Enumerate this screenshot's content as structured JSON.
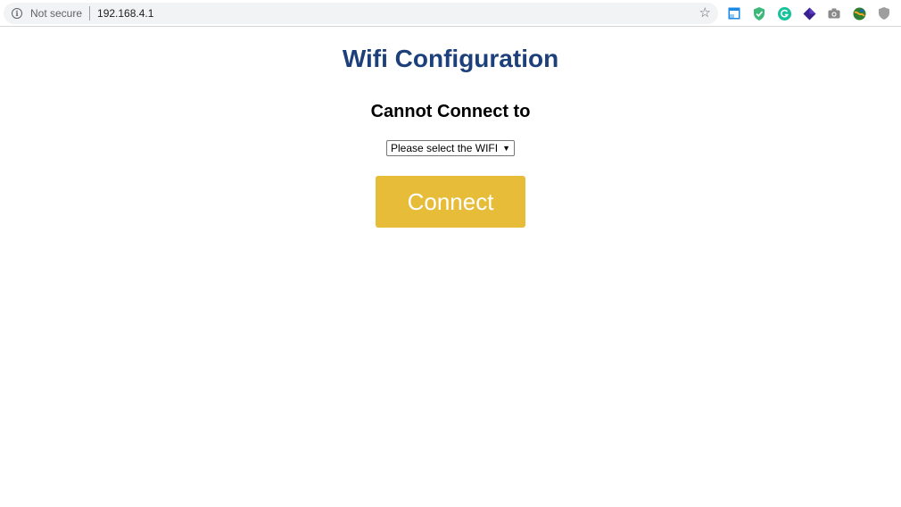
{
  "browser": {
    "security_label": "Not secure",
    "url": "192.168.4.1",
    "icons": [
      "info-icon",
      "bookmark-star-icon",
      "extension-window-icon",
      "extension-shield-check-icon",
      "extension-grammarly-icon",
      "extension-purple-gem-icon",
      "extension-camera-icon",
      "extension-globe-icon",
      "extension-gray-shield-icon"
    ]
  },
  "page": {
    "title": "Wifi Configuration",
    "subtitle": "Cannot Connect to",
    "wifi_select": {
      "selected": "Please select the WIFI"
    },
    "connect_button": "Connect"
  },
  "colors": {
    "title": "#1d3f7a",
    "button_bg": "#e7bc38",
    "button_text": "#ffffff"
  }
}
